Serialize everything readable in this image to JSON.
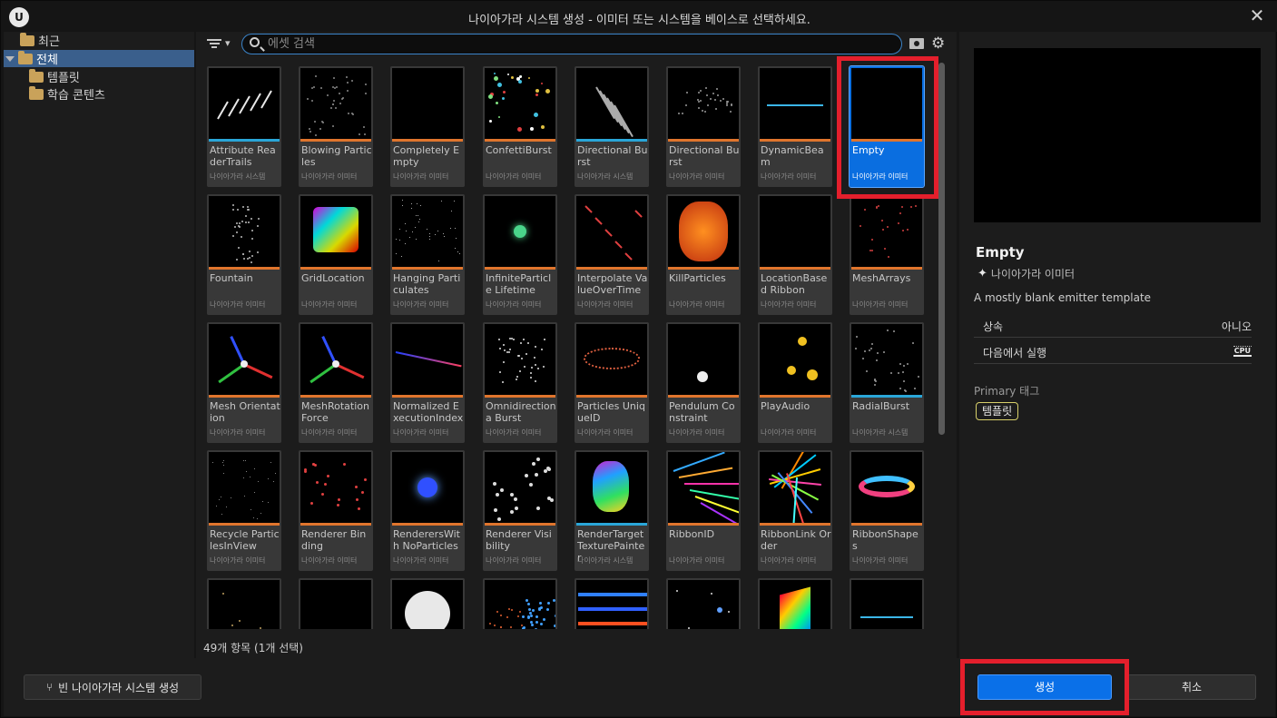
{
  "window": {
    "title": "나이아가라 시스템 생성 - 이미터 또는 시스템을 베이스로 선택하세요.",
    "logo": "U",
    "close_glyph": "✕"
  },
  "sidebar": {
    "items": [
      {
        "label": "최근"
      },
      {
        "label": "전체"
      },
      {
        "label": "템플릿"
      },
      {
        "label": "학습 콘텐츠"
      }
    ]
  },
  "toolbar": {
    "search_placeholder": "에셋 검색",
    "search_value": "",
    "filter_caret": "▾",
    "settings_glyph": "⚙"
  },
  "grid": {
    "type_emitter": "나이아가라 이미터",
    "type_system": "나이아가라 시스템",
    "tiles": [
      {
        "name": "Attribute ReaderTrails",
        "type": "나이아가라 시스템",
        "kind": "system"
      },
      {
        "name": "Blowing Particles",
        "type": "나이아가라 이미터",
        "kind": "emitter"
      },
      {
        "name": "Completely Empty",
        "type": "나이아가라 이미터",
        "kind": "emitter"
      },
      {
        "name": "ConfettiBurst",
        "type": "나이아가라 이미터",
        "kind": "emitter"
      },
      {
        "name": "Directional Burst",
        "type": "나이아가라 시스템",
        "kind": "system"
      },
      {
        "name": "Directional Burst",
        "type": "나이아가라 이미터",
        "kind": "emitter"
      },
      {
        "name": "DynamicBeam",
        "type": "나이아가라 이미터",
        "kind": "emitter"
      },
      {
        "name": "Empty",
        "type": "나이아가라 이미터",
        "kind": "emitter",
        "selected": true
      },
      {
        "name": "Fountain",
        "type": "나이아가라 이미터",
        "kind": "emitter"
      },
      {
        "name": "GridLocation",
        "type": "나이아가라 이미터",
        "kind": "emitter"
      },
      {
        "name": "Hanging Particulates",
        "type": "나이아가라 이미터",
        "kind": "emitter"
      },
      {
        "name": "InfiniteParticle Lifetime",
        "type": "나이아가라 이미터",
        "kind": "emitter"
      },
      {
        "name": "Interpolate ValueOverTime",
        "type": "나이아가라 이미터",
        "kind": "emitter"
      },
      {
        "name": "KillParticles",
        "type": "나이아가라 이미터",
        "kind": "emitter"
      },
      {
        "name": "LocationBased Ribbon",
        "type": "나이아가라 이미터",
        "kind": "emitter"
      },
      {
        "name": "MeshArrays",
        "type": "나이아가라 이미터",
        "kind": "emitter"
      },
      {
        "name": "Mesh Orientation",
        "type": "나이아가라 이미터",
        "kind": "emitter"
      },
      {
        "name": "MeshRotation Force",
        "type": "나이아가라 이미터",
        "kind": "emitter"
      },
      {
        "name": "Normalized ExecutionIndex",
        "type": "나이아가라 이미터",
        "kind": "emitter"
      },
      {
        "name": "Omnidirectiona Burst",
        "type": "나이아가라 이미터",
        "kind": "emitter"
      },
      {
        "name": "Particles UniqueID",
        "type": "나이아가라 이미터",
        "kind": "emitter"
      },
      {
        "name": "Pendulum Constraint",
        "type": "나이아가라 이미터",
        "kind": "emitter"
      },
      {
        "name": "PlayAudio",
        "type": "나이아가라 이미터",
        "kind": "emitter"
      },
      {
        "name": "RadialBurst",
        "type": "나이아가라 시스템",
        "kind": "system"
      },
      {
        "name": "Recycle ParticlesInView",
        "type": "나이아가라 이미터",
        "kind": "emitter"
      },
      {
        "name": "Renderer Binding",
        "type": "나이아가라 이미터",
        "kind": "emitter"
      },
      {
        "name": "RenderersWith NoParticles",
        "type": "나이아가라 이미터",
        "kind": "emitter"
      },
      {
        "name": "Renderer Visibility",
        "type": "나이아가라 이미터",
        "kind": "emitter"
      },
      {
        "name": "RenderTarget TexturePainter",
        "type": "나이아가라 시스템",
        "kind": "system"
      },
      {
        "name": "RibbonID",
        "type": "나이아가라 이미터",
        "kind": "emitter"
      },
      {
        "name": "RibbonLink Order",
        "type": "나이아가라 이미터",
        "kind": "emitter"
      },
      {
        "name": "RibbonShapes",
        "type": "나이아가라 이미터",
        "kind": "emitter"
      },
      {
        "name": "",
        "type": "",
        "kind": "emitter"
      },
      {
        "name": "",
        "type": "",
        "kind": "emitter"
      },
      {
        "name": "",
        "type": "",
        "kind": "emitter"
      },
      {
        "name": "",
        "type": "",
        "kind": "emitter"
      },
      {
        "name": "",
        "type": "",
        "kind": "emitter"
      },
      {
        "name": "",
        "type": "",
        "kind": "emitter"
      },
      {
        "name": "",
        "type": "",
        "kind": "emitter"
      },
      {
        "name": "",
        "type": "",
        "kind": "emitter"
      }
    ]
  },
  "status": {
    "count": "49개 항목 (1개 선택)"
  },
  "details": {
    "name": "Empty",
    "type": "나이아가라 이미터",
    "description": "A mostly blank emitter template",
    "props": [
      {
        "key": "상속",
        "value": "아니오"
      },
      {
        "key": "다음에서 실행",
        "value": "CPU"
      }
    ],
    "tag_label": "Primary 태그",
    "tag": "템플릿"
  },
  "bottom": {
    "new_system_label": "빈 나이아가라 시스템 생성",
    "create_label": "생성",
    "cancel_label": "취소"
  },
  "colors": {
    "accent": "#0a70e8",
    "emitter_bar": "#e0752d",
    "system_bar": "#2aa6d8",
    "highlight": "#e41f2c"
  }
}
